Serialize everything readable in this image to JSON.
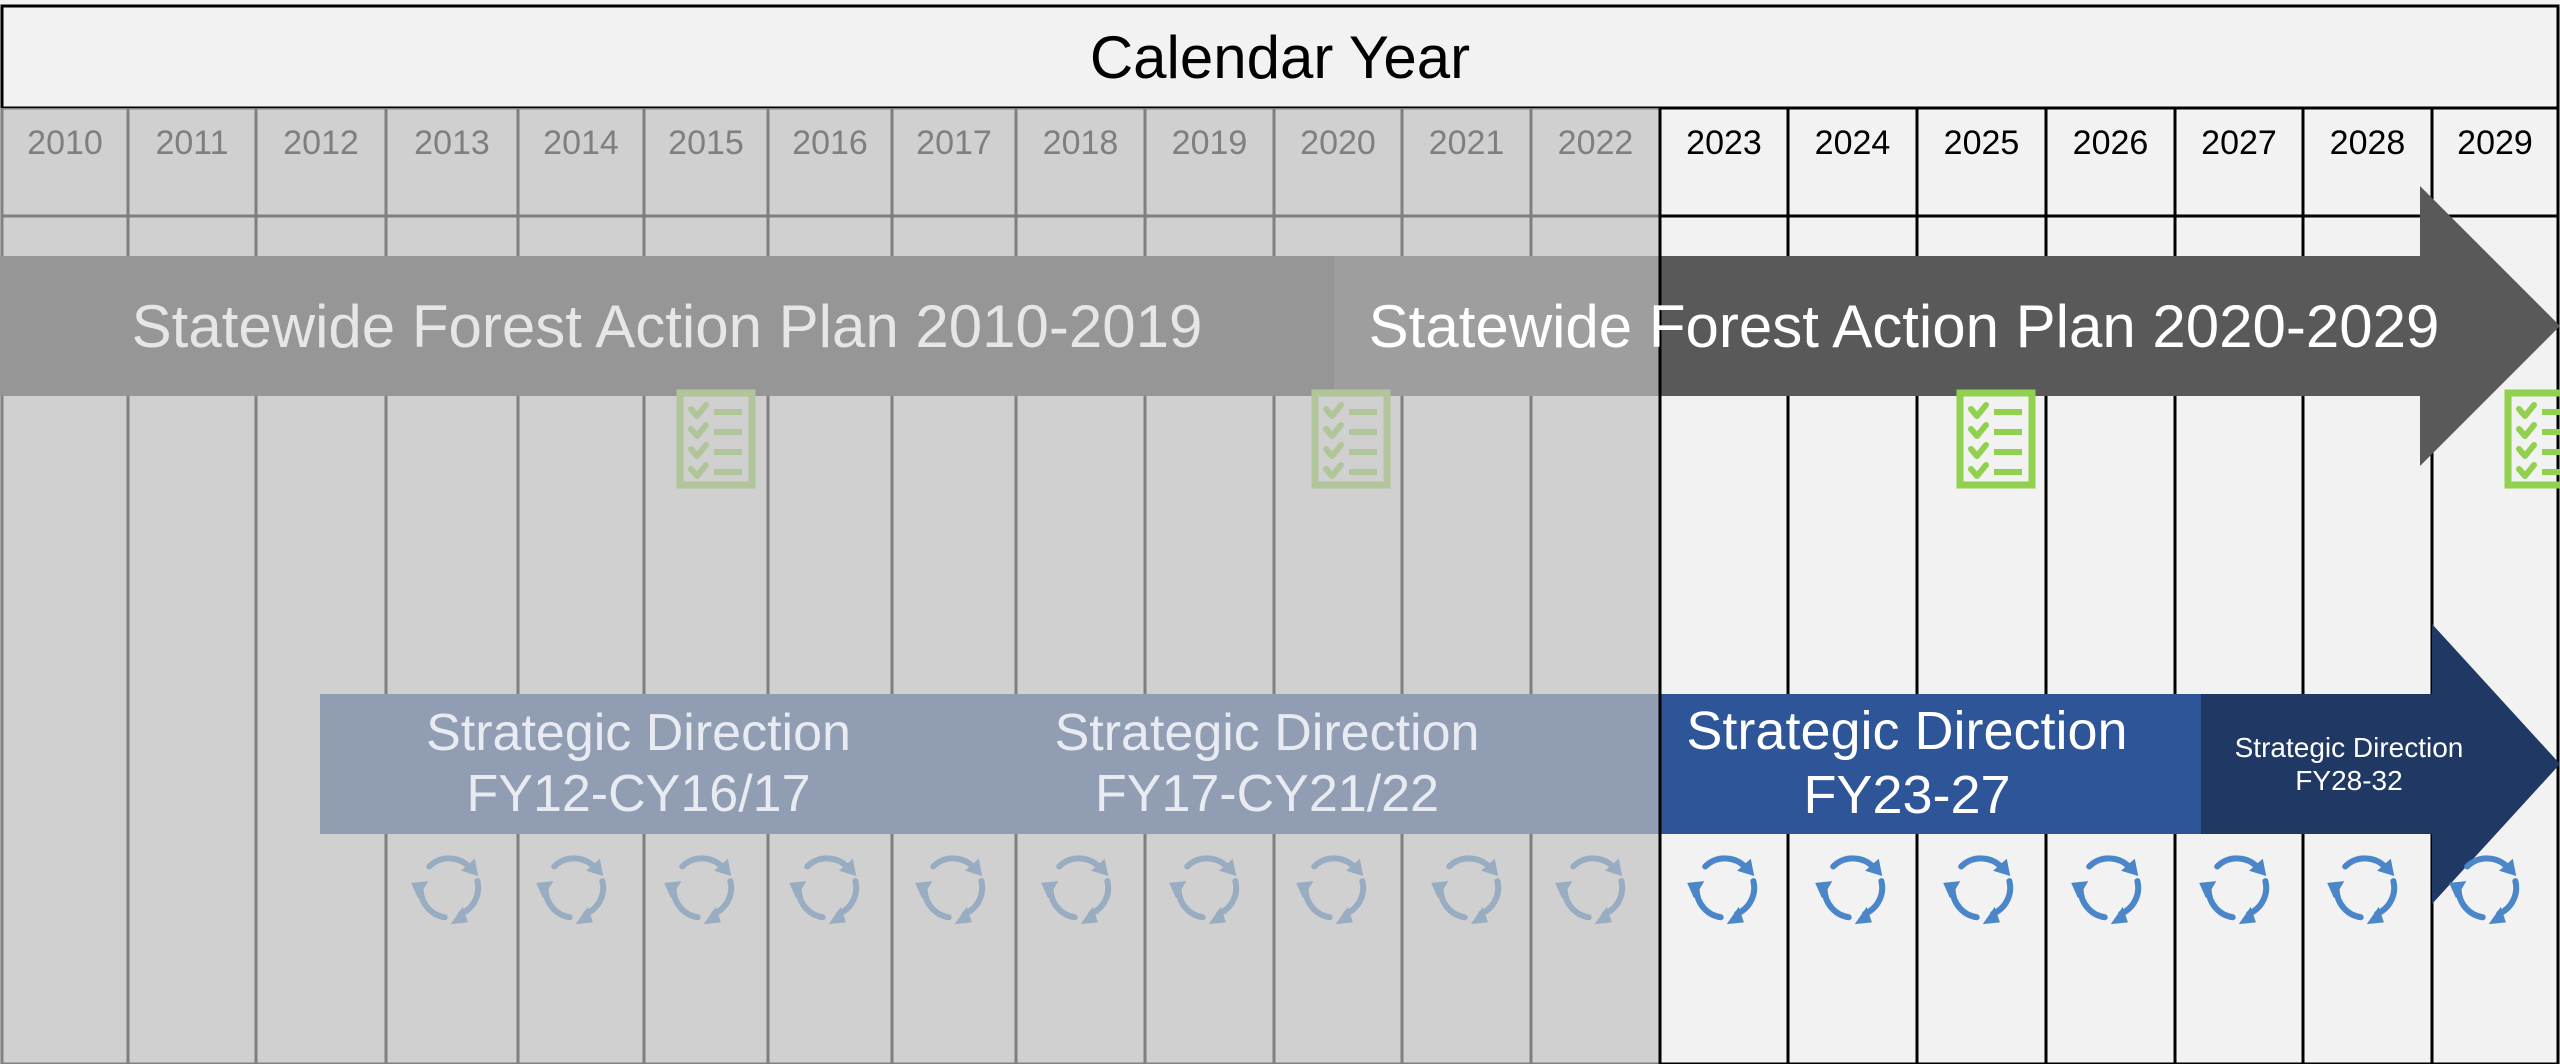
{
  "header": {
    "title": "Calendar Year"
  },
  "years": [
    "2010",
    "2011",
    "2012",
    "2013",
    "2014",
    "2015",
    "2016",
    "2017",
    "2018",
    "2019",
    "2020",
    "2021",
    "2022",
    "2023",
    "2024",
    "2025",
    "2026",
    "2027",
    "2028",
    "2029"
  ],
  "forest_plans": [
    {
      "label": "Statewide Forest Action Plan 2010-2019"
    },
    {
      "label": "Statewide Forest Action Plan 2020-2029"
    }
  ],
  "strategic_directions": [
    {
      "line1": "Strategic Direction",
      "line2": "FY12-CY16/17"
    },
    {
      "line1": "Strategic Direction",
      "line2": "FY17-CY21/22"
    },
    {
      "line1": "Strategic Direction",
      "line2": "FY23-27"
    },
    {
      "line1": "Strategic Direction",
      "line2": "FY28-32"
    }
  ],
  "icons": {
    "checklist": "checklist-icon",
    "cycle": "refresh-cycle-icon"
  },
  "colors": {
    "past_shade": "#7f7f7f",
    "forest_plan_current": "#595959",
    "checklist_green": "#92d050",
    "cycle_blue": "#4a86c8",
    "sd_current": "#2e5597",
    "sd_future": "#1f3864",
    "sd_past": "#8aa3c3"
  }
}
